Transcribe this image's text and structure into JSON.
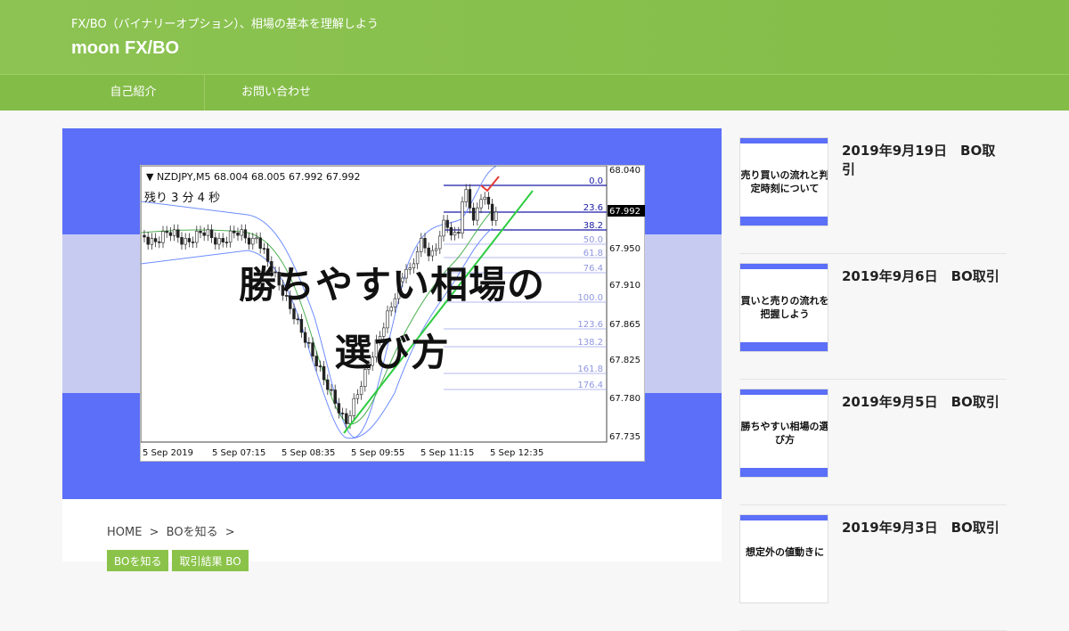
{
  "header": {
    "tagline": "FX/BO（バイナリーオプション）、相場の基本を理解しよう",
    "site_title": "moon FX/BO"
  },
  "nav": [
    {
      "label": "自己紹介"
    },
    {
      "label": "お問い合わせ"
    }
  ],
  "hero": {
    "title_line1": "勝ちやすい相場の",
    "title_line2": "選び方",
    "chart": {
      "symbol_line": "▼ NZDJPY,M5  68.004 68.005 67.992 67.992",
      "countdown": "残り 3 分 4 秒",
      "price_labels": [
        "68.040",
        "67.992",
        "67.950",
        "67.910",
        "67.865",
        "67.825",
        "67.780",
        "67.735"
      ],
      "current_price": "67.992",
      "fib_levels": [
        "0.0",
        "23.6",
        "38.2",
        "50.0",
        "61.8",
        "76.4",
        "100.0",
        "123.6",
        "138.2",
        "161.8",
        "176.4"
      ],
      "time_labels": [
        "5 Sep 2019",
        "5 Sep 07:15",
        "5 Sep 08:35",
        "5 Sep 09:55",
        "5 Sep 11:15",
        "5 Sep 12:35"
      ]
    }
  },
  "breadcrumb": [
    "HOME",
    ">",
    "BOを知る",
    ">"
  ],
  "tags": [
    "BOを知る",
    "取引結果 BO"
  ],
  "sidebar": {
    "posts": [
      {
        "title": "2019年9月19日　BO取引",
        "thumb_caption": "売り買いの流れと判定時刻について"
      },
      {
        "title": "2019年9月6日　BO取引",
        "thumb_caption": "買いと売りの流れを把握しよう"
      },
      {
        "title": "2019年9月5日　BO取引",
        "thumb_caption": "勝ちやすい相場の選び方"
      },
      {
        "title": "2019年9月3日　BO取引",
        "thumb_caption": "想定外の値動きに"
      }
    ]
  },
  "colors": {
    "header_green": "#8bc34a",
    "hero_blue": "#5b6ff8",
    "band_lavender": "#c7cbf2"
  }
}
